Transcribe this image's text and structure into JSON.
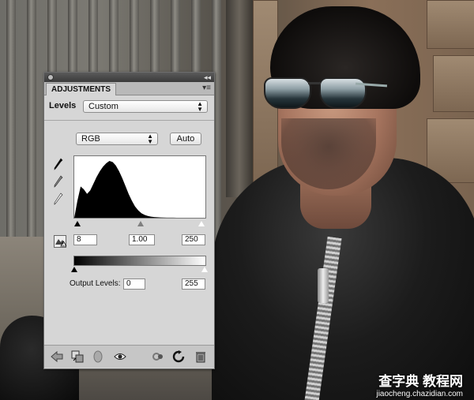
{
  "panel": {
    "tab_label": "ADJUSTMENTS",
    "collapse_glyph": "◂◂",
    "menu_glyph": "▾≡",
    "adjustment_name": "Levels",
    "preset_value": "Custom",
    "channel_value": "RGB",
    "auto_label": "Auto",
    "input_black": "8",
    "input_gamma": "1.00",
    "input_white": "250",
    "output_label": "Output Levels:",
    "output_black": "0",
    "output_white": "255",
    "histogram_levels": [
      0,
      0.3,
      0.55,
      0.5,
      0.42,
      0.48,
      0.6,
      0.72,
      0.82,
      0.9,
      0.96,
      1.0,
      0.98,
      0.92,
      0.82,
      0.7,
      0.56,
      0.42,
      0.3,
      0.2,
      0.13,
      0.08,
      0.05,
      0.03,
      0.02,
      0.012,
      0.008,
      0.005,
      0.003,
      0.002,
      0.001,
      0.001,
      0,
      0,
      0,
      0,
      0,
      0,
      0,
      0,
      0,
      0
    ]
  },
  "icons": {
    "tab_menu": "panel-menu-icon",
    "eyedroppers": [
      "black-point-eyedropper-icon",
      "gray-point-eyedropper-icon",
      "white-point-eyedropper-icon"
    ],
    "warning": "clipping-warning-icon",
    "bottom": [
      "back-arrow-icon",
      "clip-to-layer-icon",
      "layer-visibility-icon",
      "eye-icon",
      "view-previous-icon",
      "reset-icon",
      "trash-icon"
    ]
  },
  "watermark": {
    "main": "查字典 教程网",
    "sub": "jiaocheng.chazidian.com"
  }
}
